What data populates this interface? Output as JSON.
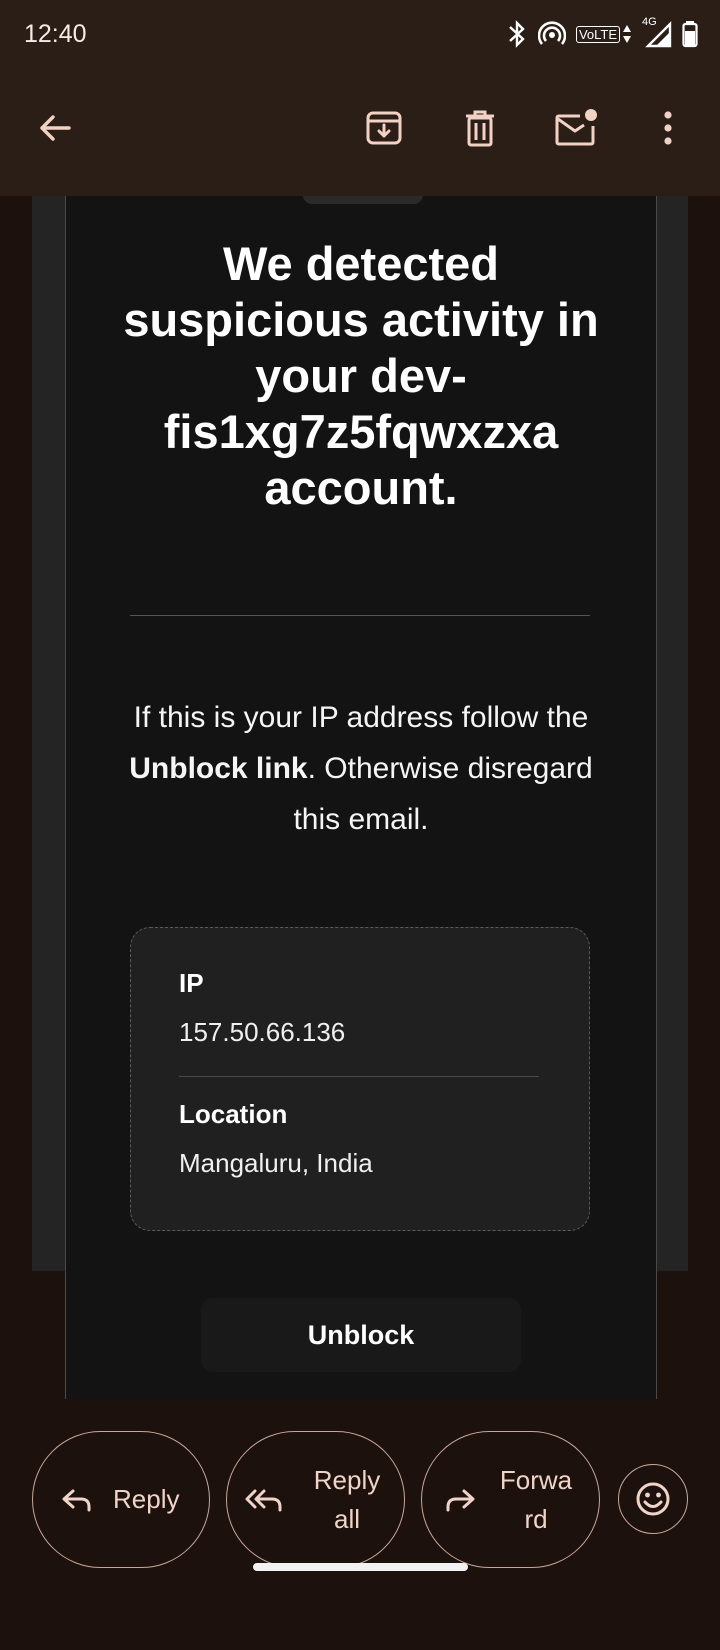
{
  "status_bar": {
    "time": "12:40",
    "icons": [
      "bluetooth-icon",
      "hotspot-icon",
      "volte-icon",
      "signal-4g-icon",
      "battery-icon"
    ],
    "volte_label": "VoLTE",
    "network_label": "4G"
  },
  "app_bar": {
    "icons": [
      "back-arrow-icon",
      "archive-icon",
      "delete-icon",
      "mark-unread-icon",
      "more-vert-icon"
    ]
  },
  "email": {
    "headline": "We detected suspicious activity in your dev-fis1xg7z5fqwxzxa account.",
    "body_part1": "If this is your IP address follow the ",
    "body_bold": "Unblock link",
    "body_part2": ". Otherwise disregard this email.",
    "ip_label": "IP",
    "ip_value": "157.50.66.136",
    "location_label": "Location",
    "location_value": "Mangaluru, India",
    "unblock_label": "Unblock"
  },
  "actions": {
    "reply_label": "Reply",
    "reply_all_label": "Reply all",
    "forward_label": "Forward",
    "emoji_icon": "add-reaction-icon"
  },
  "colors": {
    "app_bar_bg": "#2b1e17",
    "page_bg": "#1d110d",
    "card_bg": "#131313",
    "accent_outline": "#c8a79a",
    "accent_text": "#f0d4c8"
  }
}
